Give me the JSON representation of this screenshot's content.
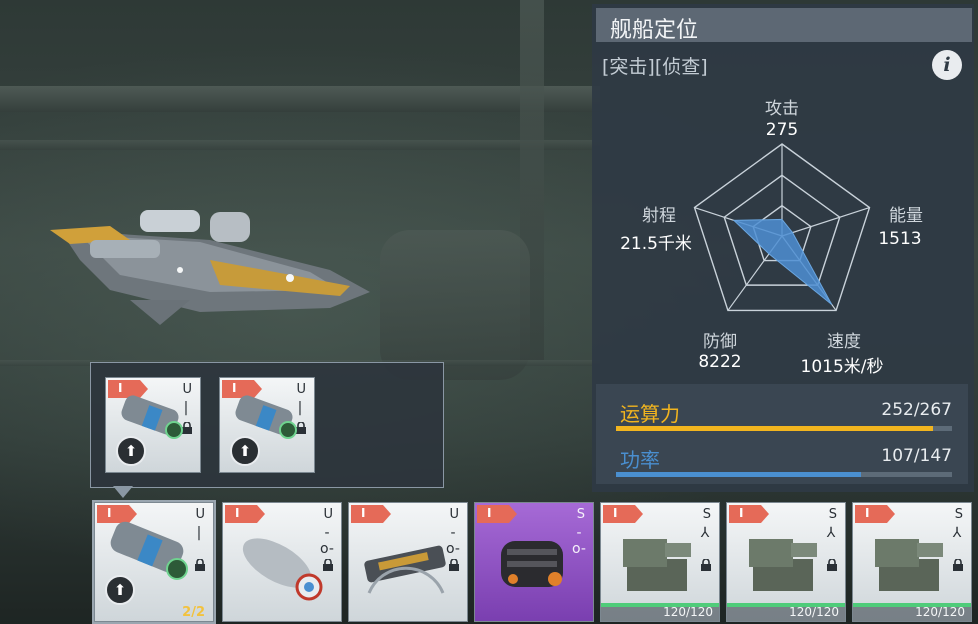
{
  "panel": {
    "title": "舰船定位",
    "tags": "[突击][侦查]",
    "info_icon": "i"
  },
  "radar": {
    "attack": {
      "label": "攻击",
      "value": "275",
      "level": 0.18
    },
    "energy": {
      "label": "能量",
      "value": "1513",
      "level": 0.12
    },
    "speed": {
      "label": "速度",
      "value": "1015米/秒",
      "level": 0.92
    },
    "defense": {
      "label": "防御",
      "value": "8222",
      "level": 0.24
    },
    "range": {
      "label": "射程",
      "value": "21.5千米",
      "level": 0.55
    }
  },
  "resources": {
    "compute": {
      "label": "运算力",
      "value": "252/267",
      "current": 252,
      "max": 267,
      "color": "#f2b51f"
    },
    "power": {
      "label": "功率",
      "value": "107/147",
      "current": 107,
      "max": 147,
      "color": "#4a8fd0"
    }
  },
  "popup_modules": [
    {
      "tier": "I",
      "slot_type": "U",
      "slot_glyph": "|"
    },
    {
      "tier": "I",
      "slot_type": "U",
      "slot_glyph": "|"
    }
  ],
  "modules": [
    {
      "tier": "I",
      "slot_type": "U",
      "slot_glyph": "|",
      "count": "2/2"
    },
    {
      "tier": "I",
      "slot_type": "U",
      "slot_glyph": "-o-"
    },
    {
      "tier": "I",
      "slot_type": "U",
      "slot_glyph": "-o-"
    },
    {
      "tier": "I",
      "slot_type": "S",
      "slot_glyph": "-o-"
    },
    {
      "tier": "I",
      "slot_type": "S",
      "slot_glyph": "⅄",
      "hp": "120/120",
      "hp_level": 1.0
    },
    {
      "tier": "I",
      "slot_type": "S",
      "slot_glyph": "⅄",
      "hp": "120/120",
      "hp_level": 1.0
    },
    {
      "tier": "I",
      "slot_type": "S",
      "slot_glyph": "⅄",
      "hp": "120/120",
      "hp_level": 1.0
    }
  ]
}
